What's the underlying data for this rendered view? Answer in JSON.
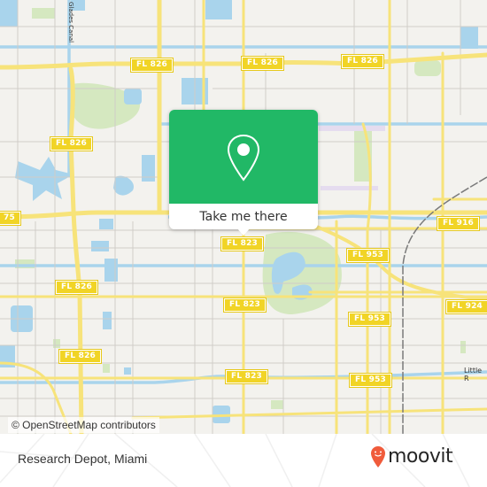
{
  "map": {
    "colors": {
      "land": "#f3f2ee",
      "water": "#a9d4ec",
      "park": "#d5e8c0",
      "major_road": "#f7e37a",
      "minor_road": "#d0cdc8",
      "rail": "#7a7a7a",
      "airport": "#e5dcef"
    },
    "shields": [
      {
        "id": "fl826-top-left",
        "label": "FL 826"
      },
      {
        "id": "fl826-top-mid",
        "label": "FL 826"
      },
      {
        "id": "fl826-top-right",
        "label": "FL 826"
      },
      {
        "id": "fl826-left",
        "label": "FL 826"
      },
      {
        "id": "i75-left",
        "label": "75"
      },
      {
        "id": "fl826-mid-left",
        "label": "FL 826"
      },
      {
        "id": "fl826-bottom-left",
        "label": "FL 826"
      },
      {
        "id": "fl823-top",
        "label": "FL 823"
      },
      {
        "id": "fl823-mid",
        "label": "FL 823"
      },
      {
        "id": "fl823-bottom",
        "label": "FL 823"
      },
      {
        "id": "fl953-top",
        "label": "FL 953"
      },
      {
        "id": "fl953-mid",
        "label": "FL 953"
      },
      {
        "id": "fl953-bottom",
        "label": "FL 953"
      },
      {
        "id": "fl916",
        "label": "FL 916"
      },
      {
        "id": "fl924",
        "label": "FL 924"
      }
    ],
    "canal_label": "Glades Canal",
    "street_label": "Little R"
  },
  "popup": {
    "button_label": "Take me there",
    "accent": "#21b866",
    "icon": "map-pin-icon"
  },
  "attribution": "© OpenStreetMap contributors",
  "footer": {
    "place_name": "Research Depot, Miami",
    "brand": "moovit",
    "brand_color": "#f05b3b",
    "logo_icon": "moovit-pin-icon"
  }
}
